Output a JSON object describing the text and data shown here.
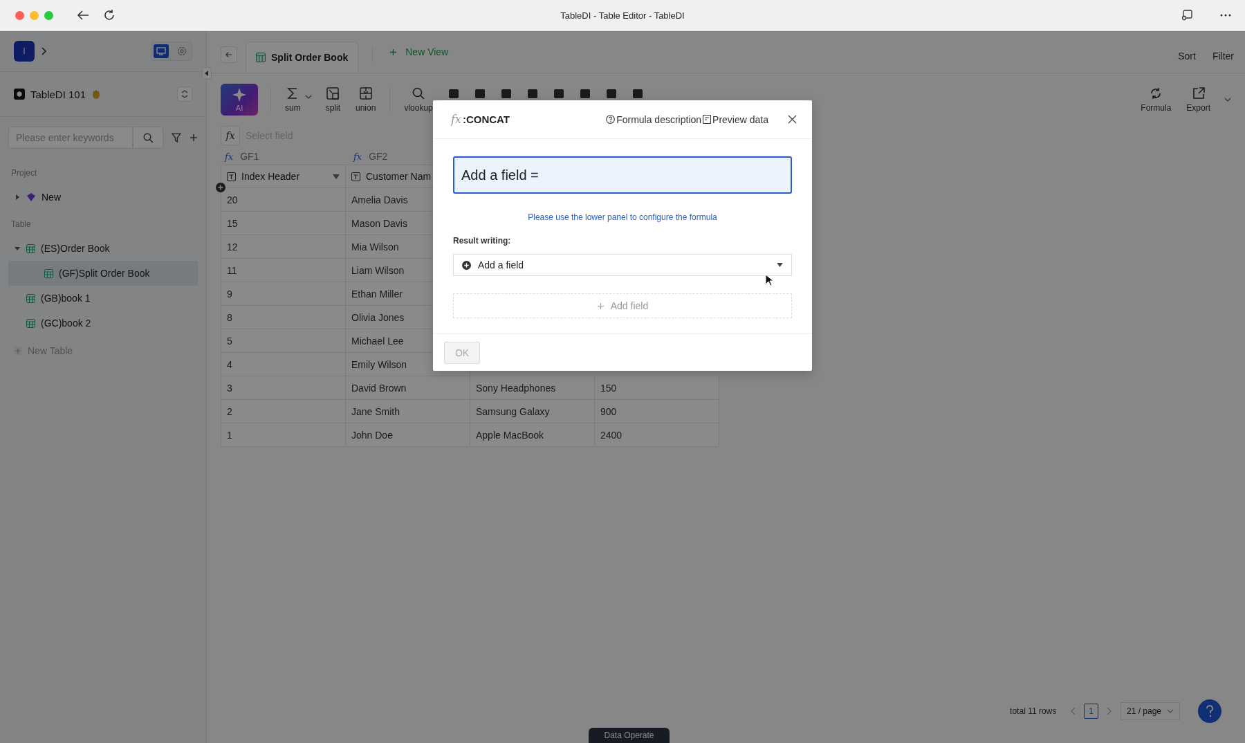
{
  "window": {
    "title": "TableDI - Table Editor - TableDI"
  },
  "sidebar": {
    "workspace_initial": "I",
    "view_toggle": [
      {
        "kind": "monitor",
        "selected": true
      },
      {
        "kind": "settings",
        "selected": false
      }
    ],
    "project_name": "TableDI 101",
    "search": {
      "placeholder": "Please enter keywords"
    },
    "project_section": {
      "label": "Project",
      "items": [
        {
          "label": "New",
          "expanded": false
        }
      ]
    },
    "table_section": {
      "label": "Table",
      "items": [
        {
          "label": "(ES)Order Book",
          "expanded": true,
          "selected": false,
          "children": [
            {
              "label": "(GF)Split Order Book",
              "selected": true
            }
          ]
        },
        {
          "label": "(GB)book 1",
          "selected": false
        },
        {
          "label": "(GC)book 2",
          "selected": false
        }
      ],
      "new_label": "New Table"
    }
  },
  "tabs": [
    {
      "label": "Split Order Book",
      "selected": true
    }
  ],
  "new_view": "New View",
  "header_actions": [
    "Sort",
    "Filter"
  ],
  "toolbar": {
    "tools": [
      {
        "label": "AI",
        "kind": "ai"
      },
      {
        "label": "sum",
        "kind": "sum"
      },
      {
        "label": "split",
        "kind": "split"
      },
      {
        "label": "union",
        "kind": "union"
      },
      {
        "label": "vlookup",
        "kind": "vlookup"
      }
    ],
    "right_tools": [
      {
        "label": "Formula",
        "kind": "formula"
      },
      {
        "label": "Export",
        "kind": "export"
      }
    ]
  },
  "formula_bar": {
    "icon": "fx",
    "placeholder": "Select field"
  },
  "table": {
    "field_groups": [
      {
        "icon": "fx",
        "label": "GF1"
      },
      {
        "icon": "fx",
        "label": "GF2"
      }
    ],
    "columns": [
      {
        "label": "Index Header"
      },
      {
        "label": "Customer Nam"
      }
    ],
    "rows": [
      {
        "cells": [
          "20",
          "Amelia Davis"
        ]
      },
      {
        "cells": [
          "15",
          "Mason Davis"
        ]
      },
      {
        "cells": [
          "12",
          "Mia Wilson"
        ]
      },
      {
        "cells": [
          "11",
          "Liam Wilson"
        ]
      },
      {
        "cells": [
          "9",
          "Ethan Miller"
        ]
      },
      {
        "cells": [
          "8",
          "Olivia Jones"
        ]
      },
      {
        "cells": [
          "5",
          "Michael Lee"
        ]
      },
      {
        "cells": [
          "4",
          "Emily Wilson"
        ]
      },
      {
        "cells": [
          "3",
          "David Brown",
          "Sony Headphones",
          "150"
        ]
      },
      {
        "cells": [
          "2",
          "Jane Smith",
          "Samsung Galaxy",
          "900"
        ]
      },
      {
        "cells": [
          "1",
          "John Doe",
          "Apple MacBook",
          "2400"
        ]
      }
    ]
  },
  "footer": {
    "total": "total 11 rows",
    "page": "1",
    "page_size": "21 / page",
    "tab": "Data Operate"
  },
  "modal": {
    "icon": "fx",
    "title": ":CONCAT",
    "links": [
      "Formula description",
      "Preview data"
    ],
    "expression": "Add a field =",
    "hint": "Please use the lower panel to configure the formula",
    "result_label": "Result writing:",
    "result_select": "Add a field",
    "add_field": "Add field",
    "ok": {
      "label": "OK",
      "disabled": true
    }
  }
}
